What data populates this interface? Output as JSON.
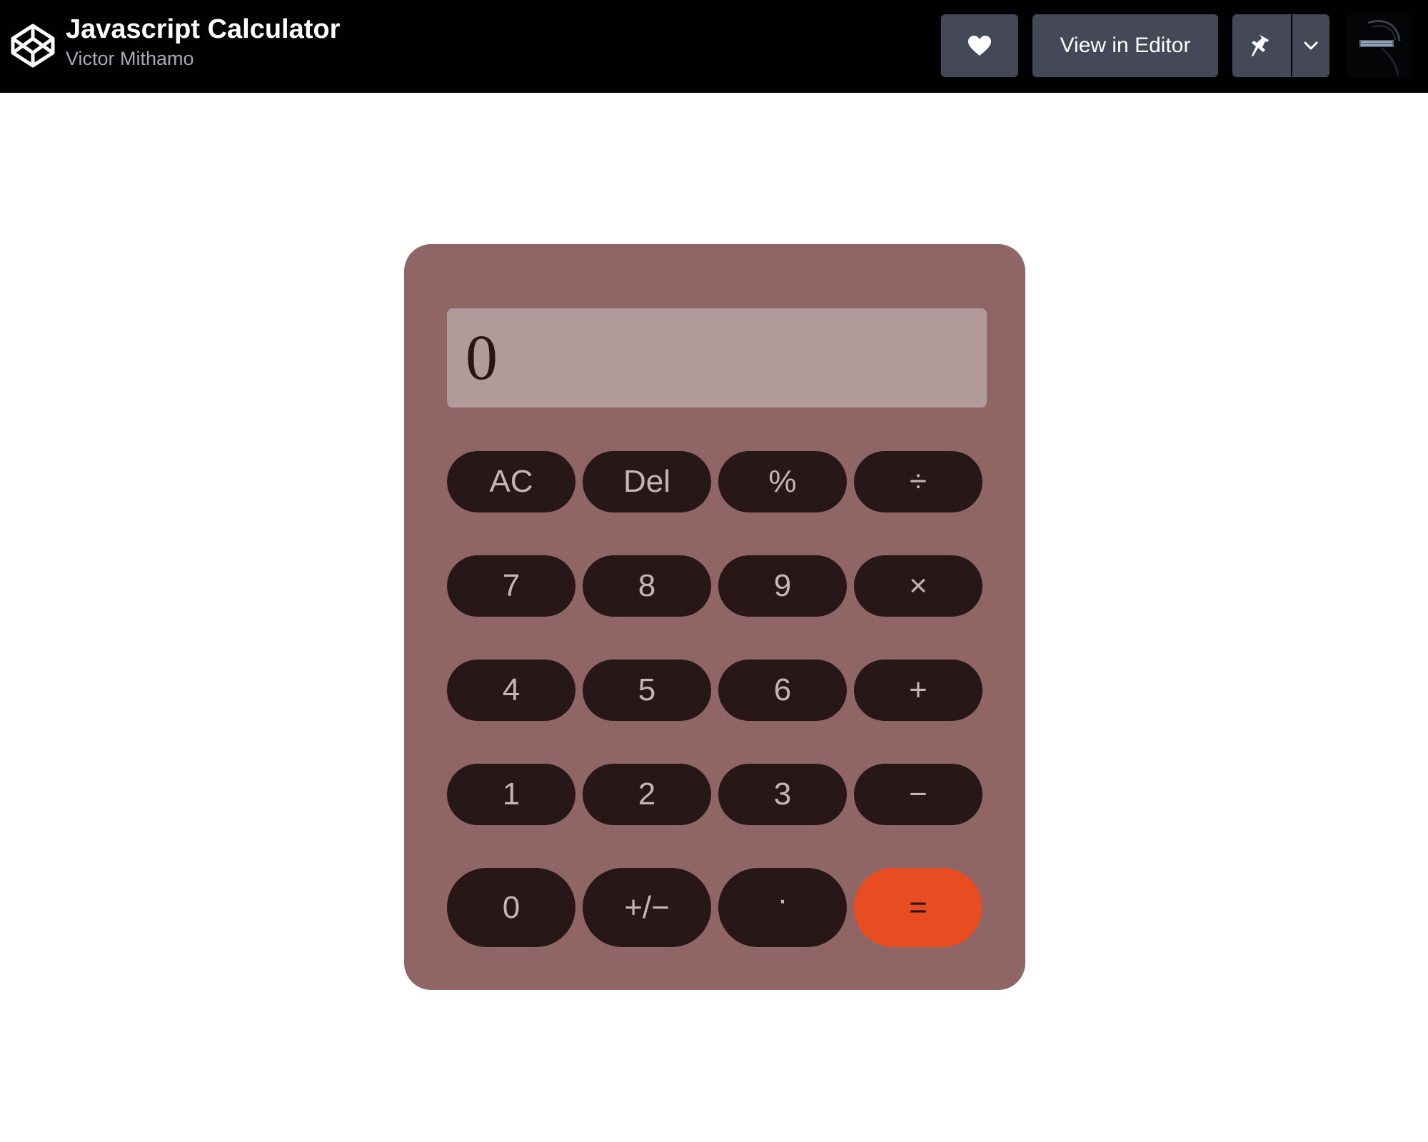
{
  "header": {
    "pen_title": "Javascript Calculator",
    "author": "Victor Mithamo",
    "view_in_editor_label": "View in Editor",
    "icons": {
      "logo": "codepen-logo-icon",
      "like": "heart-icon",
      "pin": "pin-icon",
      "more": "chevron-down-icon"
    }
  },
  "calculator": {
    "display_value": "0",
    "keys": {
      "ac": "AC",
      "del": "Del",
      "percent": "%",
      "divide": "÷",
      "seven": "7",
      "eight": "8",
      "nine": "9",
      "multiply": "×",
      "four": "4",
      "five": "5",
      "six": "6",
      "plus": "+",
      "one": "1",
      "two": "2",
      "three": "3",
      "minus": "−",
      "zero": "0",
      "toggle_sign": "+/−",
      "decimal": "·",
      "equals": "="
    }
  },
  "colors": {
    "topbar_bg": "#010101",
    "button_bg": "#444857",
    "calculator_bg": "#906565",
    "display_bg": "#b19b9a",
    "key_bg": "#271717",
    "key_text": "#c3b6b6",
    "equals_bg": "#e84d22"
  }
}
